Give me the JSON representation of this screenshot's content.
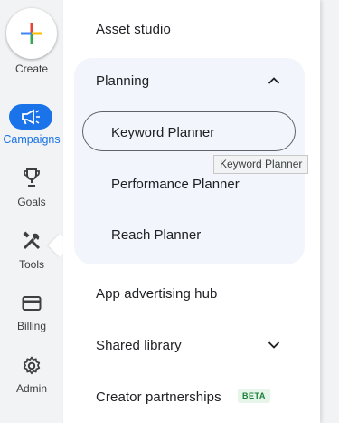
{
  "rail": {
    "create_label": "Create",
    "campaigns_label": "Campaigns",
    "goals_label": "Goals",
    "tools_label": "Tools",
    "billing_label": "Billing",
    "admin_label": "Admin",
    "active_color": "#1a73e8"
  },
  "menu": {
    "asset_studio": "Asset studio",
    "planning": {
      "label": "Planning",
      "expanded": true,
      "items": [
        "Keyword Planner",
        "Performance Planner",
        "Reach Planner"
      ],
      "selected": "Keyword Planner"
    },
    "app_advertising_hub": "App advertising hub",
    "shared_library": "Shared library",
    "creator_partnerships": "Creator partnerships",
    "beta_badge": "BETA"
  },
  "tooltip": {
    "text": "Keyword Planner"
  }
}
